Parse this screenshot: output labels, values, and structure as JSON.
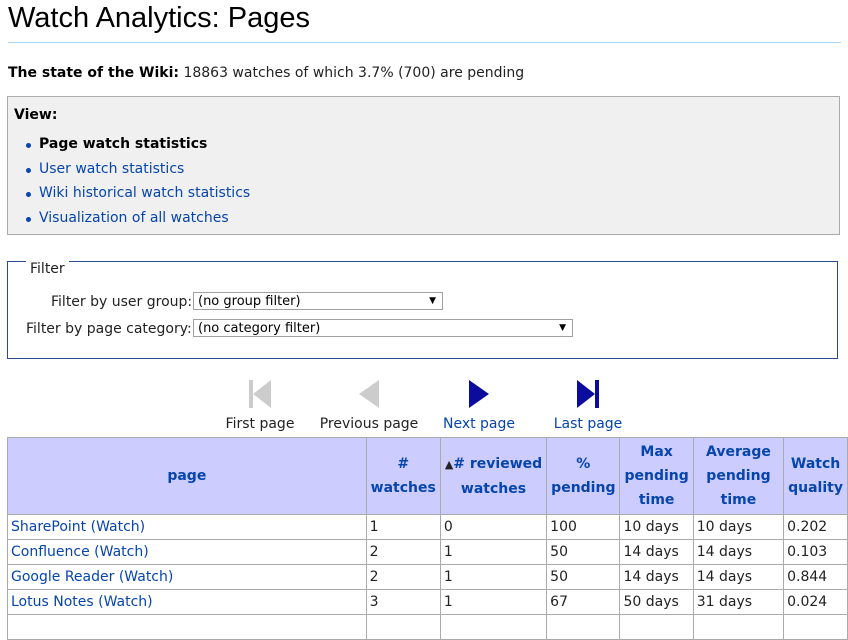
{
  "page": {
    "title": "Watch Analytics: Pages"
  },
  "state": {
    "label": "The state of the Wiki:",
    "text": "18863 watches of which 3.7% (700) are pending"
  },
  "view": {
    "heading": "View:",
    "items": [
      {
        "label": "Page watch statistics",
        "current": true
      },
      {
        "label": "User watch statistics",
        "current": false
      },
      {
        "label": "Wiki historical watch statistics",
        "current": false
      },
      {
        "label": "Visualization of all watches",
        "current": false
      }
    ]
  },
  "filter": {
    "legend": "Filter",
    "user_group_label": "Filter by user group:",
    "user_group_value": "(no group filter)",
    "category_label": "Filter by page category:",
    "category_value": "(no category filter)"
  },
  "pager": {
    "first": "First page",
    "previous": "Previous page",
    "next": "Next page",
    "last": "Last page",
    "disabled_color": "#cccccc",
    "enabled_color": "#0b0b9c"
  },
  "table": {
    "columns": [
      {
        "key": "page",
        "lines": [
          "page"
        ]
      },
      {
        "key": "watches",
        "lines": [
          "#",
          "watches"
        ]
      },
      {
        "key": "reviewed",
        "lines": [
          "# reviewed",
          "watches"
        ],
        "sort_icon": "▲"
      },
      {
        "key": "pending",
        "lines": [
          "%",
          "pending"
        ]
      },
      {
        "key": "max_pending",
        "lines": [
          "Max",
          "pending",
          "time"
        ]
      },
      {
        "key": "avg_pending",
        "lines": [
          "Average",
          "pending",
          "time"
        ]
      },
      {
        "key": "quality",
        "lines": [
          "Watch",
          "quality"
        ]
      }
    ],
    "rows": [
      {
        "page": "SharePoint",
        "watch_link": "(Watch)",
        "watches": "1",
        "reviewed": "0",
        "pending": "100",
        "max_pending": "10 days",
        "avg_pending": "10 days",
        "quality": "0.202"
      },
      {
        "page": "Confluence",
        "watch_link": "(Watch)",
        "watches": "2",
        "reviewed": "1",
        "pending": "50",
        "max_pending": "14 days",
        "avg_pending": "14 days",
        "quality": "0.103"
      },
      {
        "page": "Google Reader",
        "watch_link": "(Watch)",
        "watches": "2",
        "reviewed": "1",
        "pending": "50",
        "max_pending": "14 days",
        "avg_pending": "14 days",
        "quality": "0.844"
      },
      {
        "page": "Lotus Notes",
        "watch_link": "(Watch)",
        "watches": "3",
        "reviewed": "1",
        "pending": "67",
        "max_pending": "50 days",
        "avg_pending": "31 days",
        "quality": "0.024"
      }
    ]
  }
}
